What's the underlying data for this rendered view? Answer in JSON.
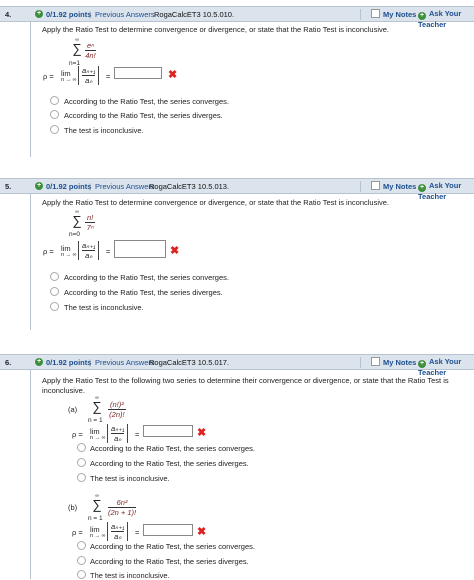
{
  "header_common": {
    "previous_answers": "Previous Answers",
    "my_notes": "My Notes",
    "ask_teacher": "Ask Your Teacher",
    "separator": "|"
  },
  "questions": [
    {
      "number": "4.",
      "points": "0/1.92 points",
      "code": "RogaCalcET3 10.5.010.",
      "prompt": "Apply the Ratio Test to determine convergence or divergence, or state that the Ratio Test is inconclusive.",
      "sum_top": "∞",
      "sum_bottom": "n=1",
      "term_num": "eⁿ",
      "term_den": "4n!",
      "rho_label": "ρ =",
      "lim": "lim",
      "lim_sub": "n → ∞",
      "ratio_num": "aₙ₊₁",
      "ratio_den": "aₙ",
      "equals": "=",
      "options": [
        "According to the Ratio Test, the series converges.",
        "According to the Ratio Test, the series diverges.",
        "The test is inconclusive."
      ]
    },
    {
      "number": "5.",
      "points": "0/1.92 points",
      "code": "RogaCalcET3 10.5.013.",
      "prompt": "Apply the Ratio Test to determine convergence or divergence, or state that the Ratio Test is inconclusive.",
      "sum_top": "∞",
      "sum_bottom": "n=0",
      "term_num": "n!",
      "term_den": "7ⁿ",
      "rho_label": "ρ =",
      "lim": "lim",
      "lim_sub": "n → ∞",
      "ratio_num": "aₙ₊₁",
      "ratio_den": "aₙ",
      "equals": "=",
      "options": [
        "According to the Ratio Test, the series converges.",
        "According to the Ratio Test, the series diverges.",
        "The test is inconclusive."
      ]
    },
    {
      "number": "6.",
      "points": "0/1.92 points",
      "code": "RogaCalcET3 10.5.017.",
      "prompt_line1": "Apply the Ratio Test to the following two series to determine their convergence or divergence, or state that the Ratio Test is",
      "prompt_line2": "inconclusive.",
      "parts": [
        {
          "label": "(a)",
          "sum_top": "∞",
          "sum_bottom": "n = 1",
          "term_num": "(n!)²",
          "term_den": "(2n)!",
          "options": [
            "According to the Ratio Test, the series converges.",
            "According to the Ratio Test, the series diverges.",
            "The test is inconclusive."
          ]
        },
        {
          "label": "(b)",
          "sum_top": "∞",
          "sum_bottom": "n = 1",
          "term_num": "6n²",
          "term_den": "(2n + 1)!",
          "options": [
            "According to the Ratio Test, the series converges.",
            "According to the Ratio Test, the series diverges.",
            "The test is inconclusive."
          ]
        }
      ],
      "rho_label": "ρ =",
      "lim": "lim",
      "lim_sub": "n → ∞",
      "ratio_num": "aₙ₊₁",
      "ratio_den": "aₙ",
      "equals": "="
    }
  ],
  "colors": {
    "header_bg": "#dbe3ec",
    "link": "#1d4f91",
    "wrong": "#dd2222",
    "plus_green": "#3b8f3b"
  }
}
